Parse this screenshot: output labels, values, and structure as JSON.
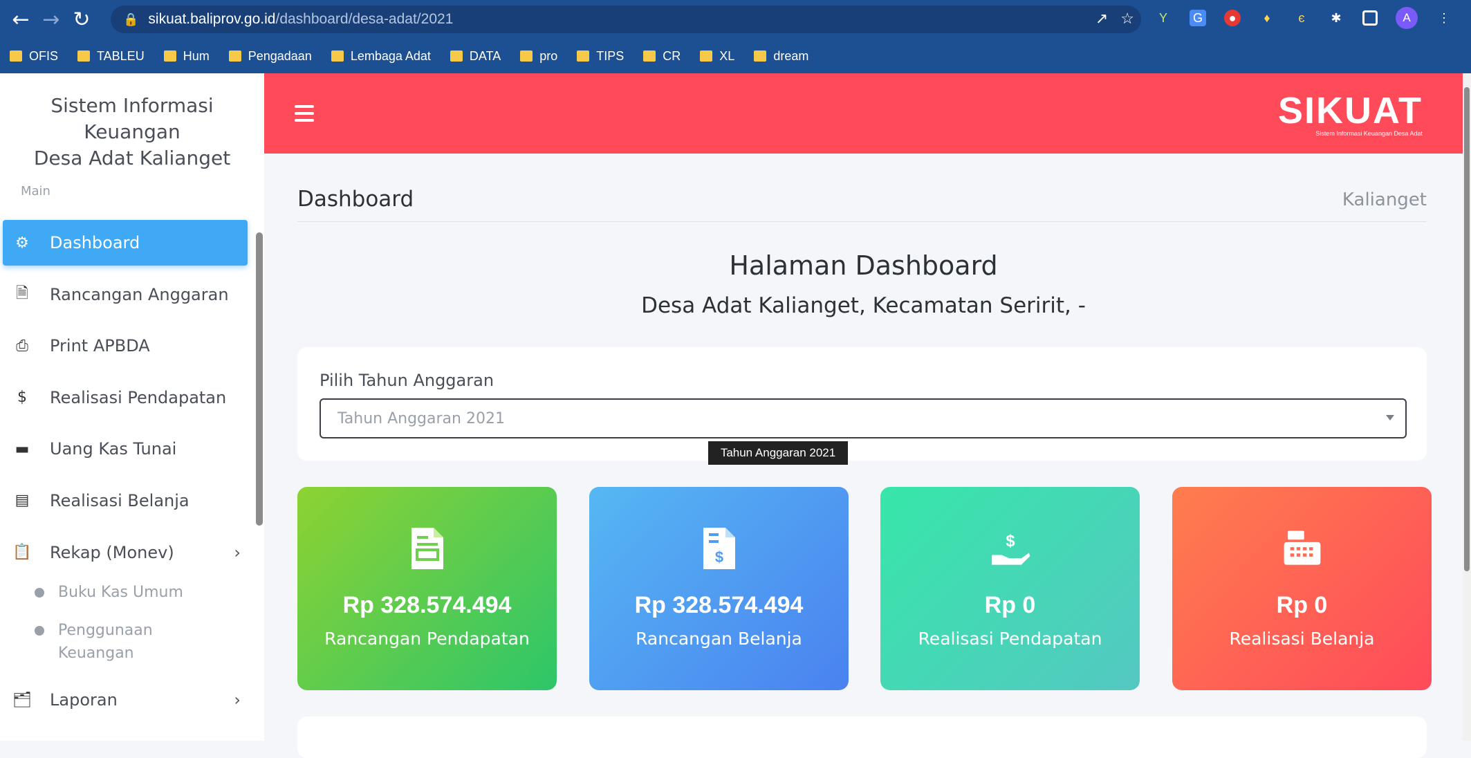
{
  "browser": {
    "url_domain": "sikuat.baliprov.go.id",
    "url_path": "/dashboard/desa-adat/2021",
    "profile_initial": "A",
    "bookmarks": [
      "OFIS",
      "TABLEU",
      "Hum",
      "Pengadaan",
      "Lembaga Adat",
      "DATA",
      "pro",
      "TIPS",
      "CR",
      "XL",
      "dream"
    ]
  },
  "sidebar": {
    "brand_line1": "Sistem Informasi Keuangan",
    "brand_line2": "Desa Adat Kalianget",
    "section_label": "Main",
    "items": [
      {
        "label": "Dashboard",
        "icon": "dashboard-icon",
        "active": true
      },
      {
        "label": "Rancangan Anggaran",
        "icon": "file-invoice-icon"
      },
      {
        "label": "Print APBDA",
        "icon": "printer-icon"
      },
      {
        "label": "Realisasi Pendapatan",
        "icon": "hand-dollar-icon"
      },
      {
        "label": "Uang Kas Tunai",
        "icon": "wallet-icon"
      },
      {
        "label": "Realisasi Belanja",
        "icon": "cash-register-icon"
      },
      {
        "label": "Rekap (Monev)",
        "icon": "clipboard-check-icon"
      }
    ],
    "sub_items": [
      "Buku Kas Umum",
      "Penggunaan Keuangan"
    ],
    "report_item": "Laporan"
  },
  "topbar": {
    "logo_text": "SIKUAT",
    "logo_subtitle": "Sistem Informasi Keuangan Desa Adat"
  },
  "main": {
    "page_title": "Dashboard",
    "breadcrumb": "Kalianget",
    "hero_title": "Halaman Dashboard",
    "hero_subtitle": "Desa Adat Kalianget, Kecamatan Seririt, -",
    "year_label": "Pilih Tahun Anggaran",
    "year_value": "Tahun Anggaran 2021",
    "tooltip": "Tahun Anggaran 2021",
    "stats": [
      {
        "value": "Rp 328.574.494",
        "label": "Rancangan Pendapatan"
      },
      {
        "value": "Rp 328.574.494",
        "label": "Rancangan Belanja"
      },
      {
        "value": "Rp 0",
        "label": "Realisasi Pendapatan"
      },
      {
        "value": "Rp 0",
        "label": "Realisasi Belanja"
      }
    ]
  },
  "colors": {
    "topbar": "#ff4a5a",
    "active_item": "#3fa9f5",
    "browser": "#1d4f93"
  }
}
